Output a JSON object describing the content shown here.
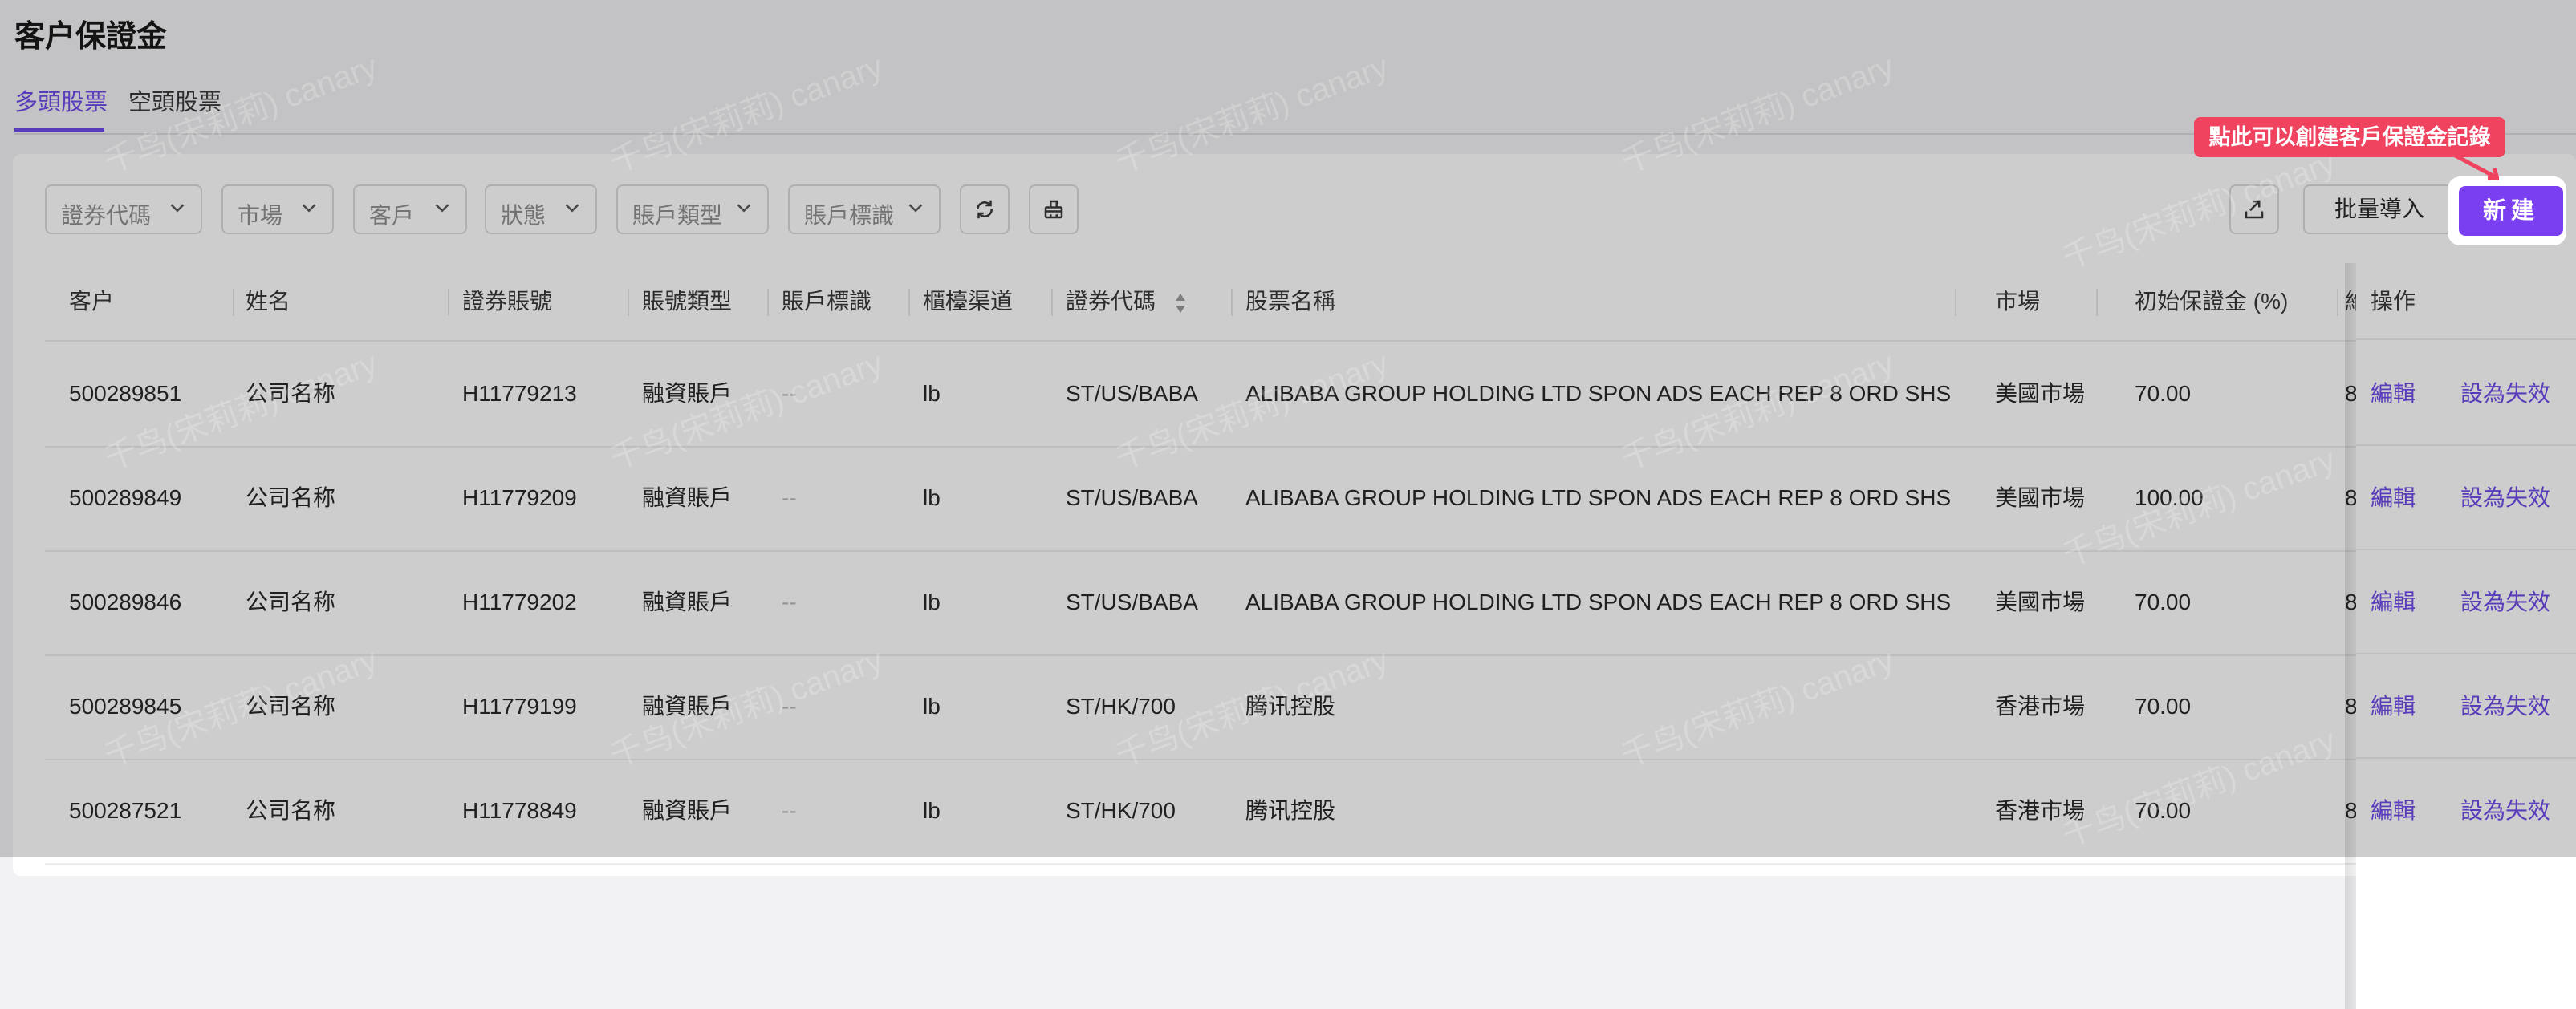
{
  "page": {
    "title": "客户保證金"
  },
  "tabs": [
    {
      "label": "多頭股票",
      "active": true
    },
    {
      "label": "空頭股票",
      "active": false
    }
  ],
  "filters": {
    "items": [
      "證券代碼",
      "市場",
      "客戶",
      "狀態",
      "賬戶類型",
      "賬戶標識"
    ],
    "refresh_icon": "refresh-icon",
    "clear_icon": "clear-filter-icon"
  },
  "toolbar": {
    "export_icon": "export-icon",
    "import_label": "批量導入",
    "new_label": "新建"
  },
  "guide": {
    "tooltip": "點此可以創建客戶保證金記錄"
  },
  "table": {
    "columns": [
      "客户",
      "姓名",
      "證券賬號",
      "賬號類型",
      "賬戶標識",
      "櫃檯渠道",
      "證券代碼",
      "股票名稱",
      "市場",
      "初始保證金 (%)",
      "維",
      "操作"
    ],
    "rows": [
      {
        "customer": "500289851",
        "name": "公司名称",
        "account": "H11779213",
        "acct_type": "融資賬戶",
        "acct_flag": "--",
        "channel": "lb",
        "code": "ST/US/BABA",
        "stock_name": "ALIBABA GROUP HOLDING LTD SPON ADS EACH REP 8 ORD SHS",
        "market": "美國市場",
        "initial_margin": "70.00",
        "maint": "8"
      },
      {
        "customer": "500289849",
        "name": "公司名称",
        "account": "H11779209",
        "acct_type": "融資賬戶",
        "acct_flag": "--",
        "channel": "lb",
        "code": "ST/US/BABA",
        "stock_name": "ALIBABA GROUP HOLDING LTD SPON ADS EACH REP 8 ORD SHS",
        "market": "美國市場",
        "initial_margin": "100.00",
        "maint": "8"
      },
      {
        "customer": "500289846",
        "name": "公司名称",
        "account": "H11779202",
        "acct_type": "融資賬戶",
        "acct_flag": "--",
        "channel": "lb",
        "code": "ST/US/BABA",
        "stock_name": "ALIBABA GROUP HOLDING LTD SPON ADS EACH REP 8 ORD SHS",
        "market": "美國市場",
        "initial_margin": "70.00",
        "maint": "8"
      },
      {
        "customer": "500289845",
        "name": "公司名称",
        "account": "H11779199",
        "acct_type": "融資賬戶",
        "acct_flag": "--",
        "channel": "lb",
        "code": "ST/HK/700",
        "stock_name": "腾讯控股",
        "market": "香港市場",
        "initial_margin": "70.00",
        "maint": "8"
      },
      {
        "customer": "500287521",
        "name": "公司名称",
        "account": "H11778849",
        "acct_type": "融資賬戶",
        "acct_flag": "--",
        "channel": "lb",
        "code": "ST/HK/700",
        "stock_name": "腾讯控股",
        "market": "香港市場",
        "initial_margin": "70.00",
        "maint": "8"
      }
    ],
    "actions": {
      "edit": "編輯",
      "invalidate": "設為失效"
    }
  },
  "watermark": {
    "text": "千鸟(宋莉莉) canary"
  },
  "colors": {
    "accent": "#6b46e5",
    "button": "#7b3ff2",
    "tooltip": "#f0435f"
  }
}
